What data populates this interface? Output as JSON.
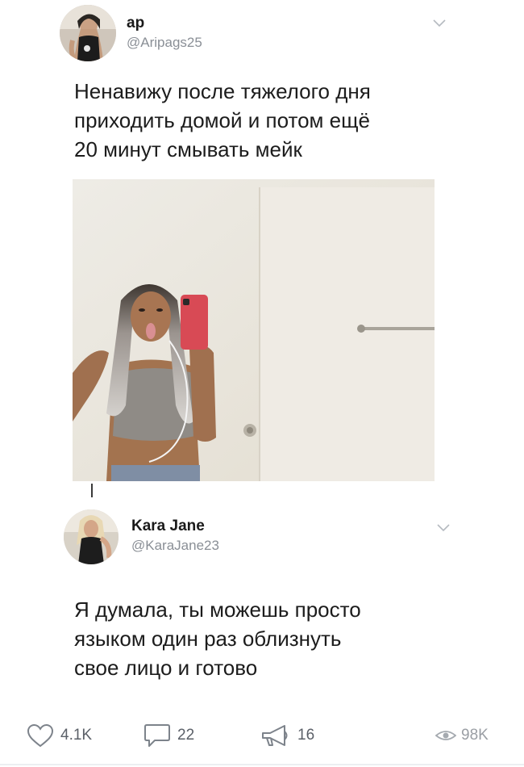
{
  "posts": [
    {
      "author": {
        "name": "ap",
        "handle": "@Aripags25"
      },
      "text": "Ненавижу после тяжелого дня\nприходить домой и потом ещё\n20 минут смывать мейк",
      "has_photo": true
    },
    {
      "author": {
        "name": "Kara Jane",
        "handle": "@KaraJane23"
      },
      "text": "Я думала, ты можешь просто\nязыком один раз облизнуть\nсвое лицо и готово",
      "has_photo": false
    }
  ],
  "actions": {
    "likes": "4.1K",
    "comments": "22",
    "reposts": "16",
    "views": "98K"
  },
  "icons": {
    "more": "chevron-down-icon",
    "like": "heart-icon",
    "comment": "comment-icon",
    "repost": "megaphone-icon",
    "views": "eye-icon"
  },
  "colors": {
    "handle": "#8a8f96",
    "text": "#1c1c1c",
    "icon": "#7d838b"
  }
}
